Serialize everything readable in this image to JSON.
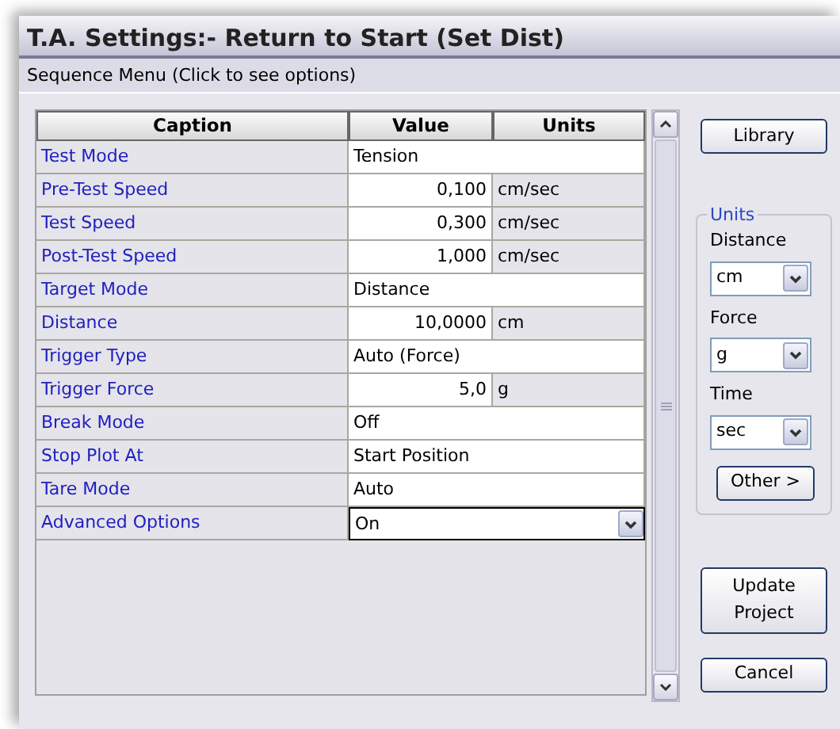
{
  "window": {
    "title": "T.A. Settings:- Return to Start (Set Dist)"
  },
  "sequence_menu": "Sequence Menu (Click to see options)",
  "table": {
    "columns": [
      "Caption",
      "Value",
      "Units"
    ],
    "rows": [
      {
        "kind": "text",
        "caption": "Test Mode",
        "value": "Tension"
      },
      {
        "kind": "number",
        "caption": "Pre-Test Speed",
        "value": "0,100",
        "units": "cm/sec"
      },
      {
        "kind": "number",
        "caption": "Test Speed",
        "value": "0,300",
        "units": "cm/sec"
      },
      {
        "kind": "number",
        "caption": "Post-Test Speed",
        "value": "1,000",
        "units": "cm/sec"
      },
      {
        "kind": "text",
        "caption": "Target Mode",
        "value": "Distance"
      },
      {
        "kind": "number",
        "caption": "Distance",
        "value": "10,0000",
        "units": "cm"
      },
      {
        "kind": "text",
        "caption": "Trigger Type",
        "value": "Auto (Force)"
      },
      {
        "kind": "number",
        "caption": "Trigger Force",
        "value": "5,0",
        "units": "g"
      },
      {
        "kind": "text",
        "caption": "Break Mode",
        "value": "Off"
      },
      {
        "kind": "text",
        "caption": "Stop Plot At",
        "value": "Start Position"
      },
      {
        "kind": "text",
        "caption": "Tare Mode",
        "value": "Auto"
      },
      {
        "kind": "select",
        "caption": "Advanced Options",
        "value": "On"
      }
    ]
  },
  "library_button": "Library",
  "units": {
    "title": "Units",
    "fields": [
      {
        "label": "Distance",
        "value": "cm"
      },
      {
        "label": "Force",
        "value": "g"
      },
      {
        "label": "Time",
        "value": "sec"
      }
    ],
    "other_button": "Other >"
  },
  "buttons": [
    "Update Project",
    "Cancel"
  ]
}
